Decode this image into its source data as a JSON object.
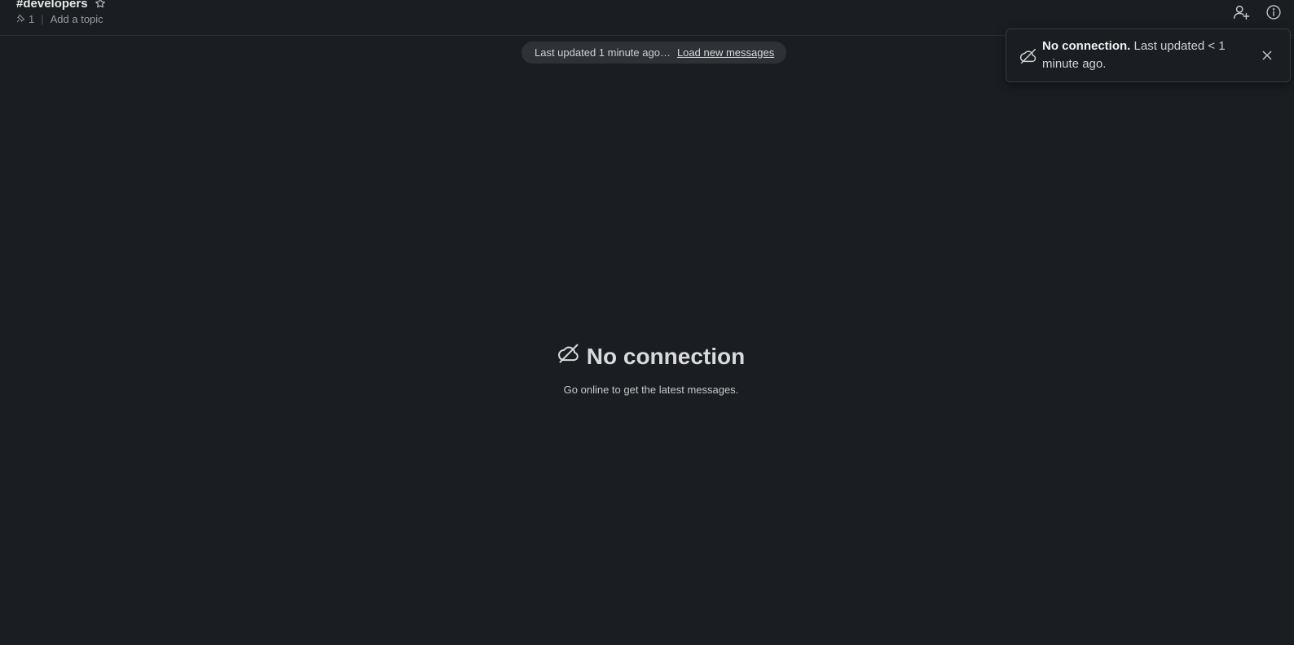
{
  "header": {
    "channel_name": "#developers",
    "pin_count": "1",
    "add_topic": "Add a topic"
  },
  "banner": {
    "status_text": "Last updated 1 minute ago…",
    "load_link": "Load new messages"
  },
  "toast": {
    "title": "No connection.",
    "body": " Last updated < 1 minute ago."
  },
  "empty_state": {
    "title": "No connection",
    "subtitle": "Go online to get the latest messages."
  },
  "icons": {
    "star": "star-icon",
    "pin": "pin-icon",
    "add_member": "add-member-icon",
    "info": "info-icon",
    "offline": "cloud-offline-icon",
    "close": "close-icon"
  }
}
